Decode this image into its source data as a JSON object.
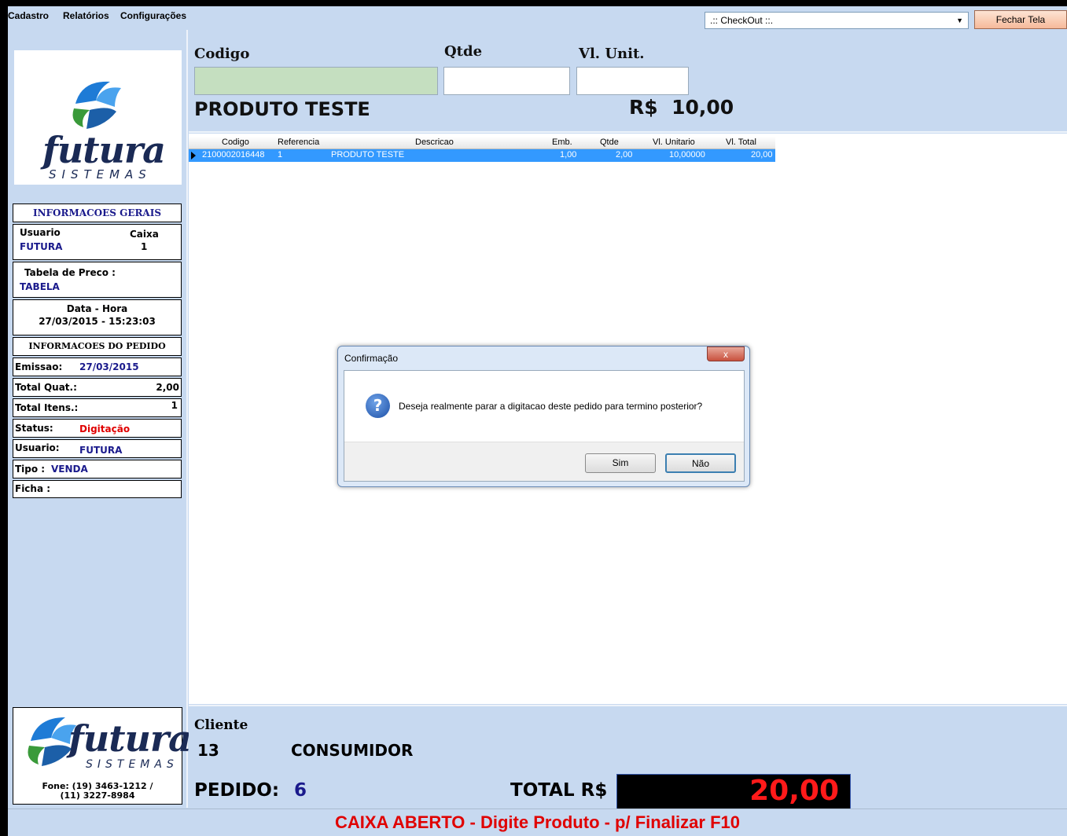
{
  "menu": {
    "items": [
      "Cadastro",
      "Relatórios",
      "Configurações"
    ],
    "checkout_value": ".:: CheckOut ::.",
    "close_label": "Fechar Tela"
  },
  "sidebar": {
    "logo_brand": "futura",
    "logo_sub": "SISTEMAS",
    "general_title": "INFORMACOES GERAIS",
    "usuario_label": "Usuario",
    "usuario_value": "FUTURA",
    "caixa_label": "Caixa",
    "caixa_value": "1",
    "tabela_label": "Tabela de Preco :",
    "tabela_value": "TABELA",
    "datahora_label": "Data - Hora",
    "datahora_value": "27/03/2015 - 15:23:03",
    "order_title": "INFORMACOES DO PEDIDO",
    "emissao_label": "Emissao:",
    "emissao_value": "27/03/2015",
    "total_quat_label": "Total Quat.:",
    "total_quat_value": "2,00",
    "total_itens_label": "Total Itens.:",
    "total_itens_value": "1",
    "status_label": "Status:",
    "status_value": "Digitação",
    "usuario2_label": "Usuario:",
    "usuario2_value": "FUTURA",
    "tipo_label": "Tipo :",
    "tipo_value": "VENDA",
    "ficha_label": "Ficha :",
    "phone_line1": "Fone: (19) 3463-1212 /",
    "phone_line2": "(11) 3227-8984"
  },
  "entry": {
    "codigo_label": "Codigo",
    "qtde_label": "Qtde",
    "vlunit_label": "Vl. Unit.",
    "product_name": "PRODUTO TESTE",
    "currency": "R$",
    "price": "10,00"
  },
  "grid": {
    "headers": [
      "Codigo",
      "Referencia",
      "Descricao",
      "Emb.",
      "Qtde",
      "Vl. Unitario",
      "Vl. Total"
    ],
    "rows": [
      [
        "2100002016448",
        "1",
        "PRODUTO TESTE",
        "1,00",
        "2,00",
        "10,00000",
        "20,00"
      ]
    ]
  },
  "bottom": {
    "cliente_label": "Cliente",
    "cliente_code": "13",
    "cliente_name": "CONSUMIDOR",
    "pedido_label": "PEDIDO:",
    "pedido_value": "6",
    "total_label": "TOTAL R$",
    "total_value": "20,00",
    "status_message": "CAIXA ABERTO - Digite Produto - p/ Finalizar F10"
  },
  "dialog": {
    "title": "Confirmação",
    "close_glyph": "x",
    "message": "Deseja realmente parar a digitacao deste pedido para termino posterior?",
    "yes_label": "Sim",
    "no_label": "Não"
  },
  "colors": {
    "panel_bg": "#c7d9f0",
    "selection_blue": "#3399ff",
    "accent_red": "#e00000",
    "text_blue": "#1a1a8c"
  }
}
